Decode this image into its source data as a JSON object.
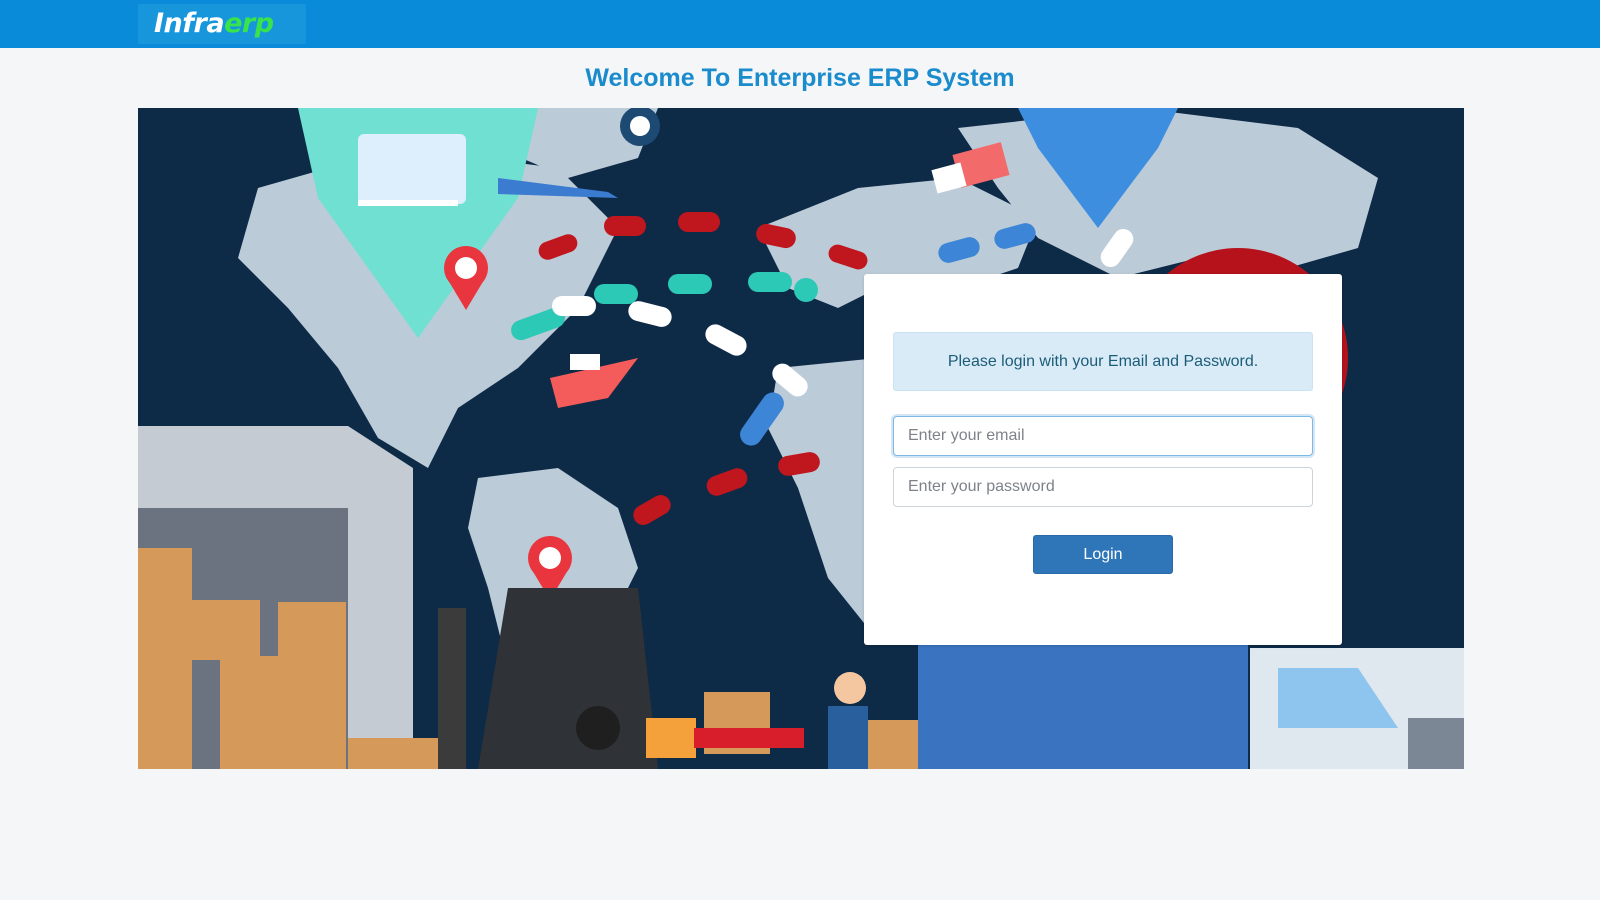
{
  "app": {
    "logo_part1": "Infra",
    "logo_part2": "erp",
    "brand_color": "#0a8bd9"
  },
  "welcome": {
    "title": "Welcome To Enterprise ERP System"
  },
  "hero": {
    "illustration": "world-map-logistics-illustration"
  },
  "login": {
    "message": "Please login with your Email and Password.",
    "email_placeholder": "Enter your email",
    "password_placeholder": "Enter your password",
    "button_label": "Login"
  },
  "colors": {
    "title": "#1a8bcd",
    "button": "#2f76b9",
    "alert_bg": "#d8ebf7",
    "logo_accent": "#39e44b"
  }
}
